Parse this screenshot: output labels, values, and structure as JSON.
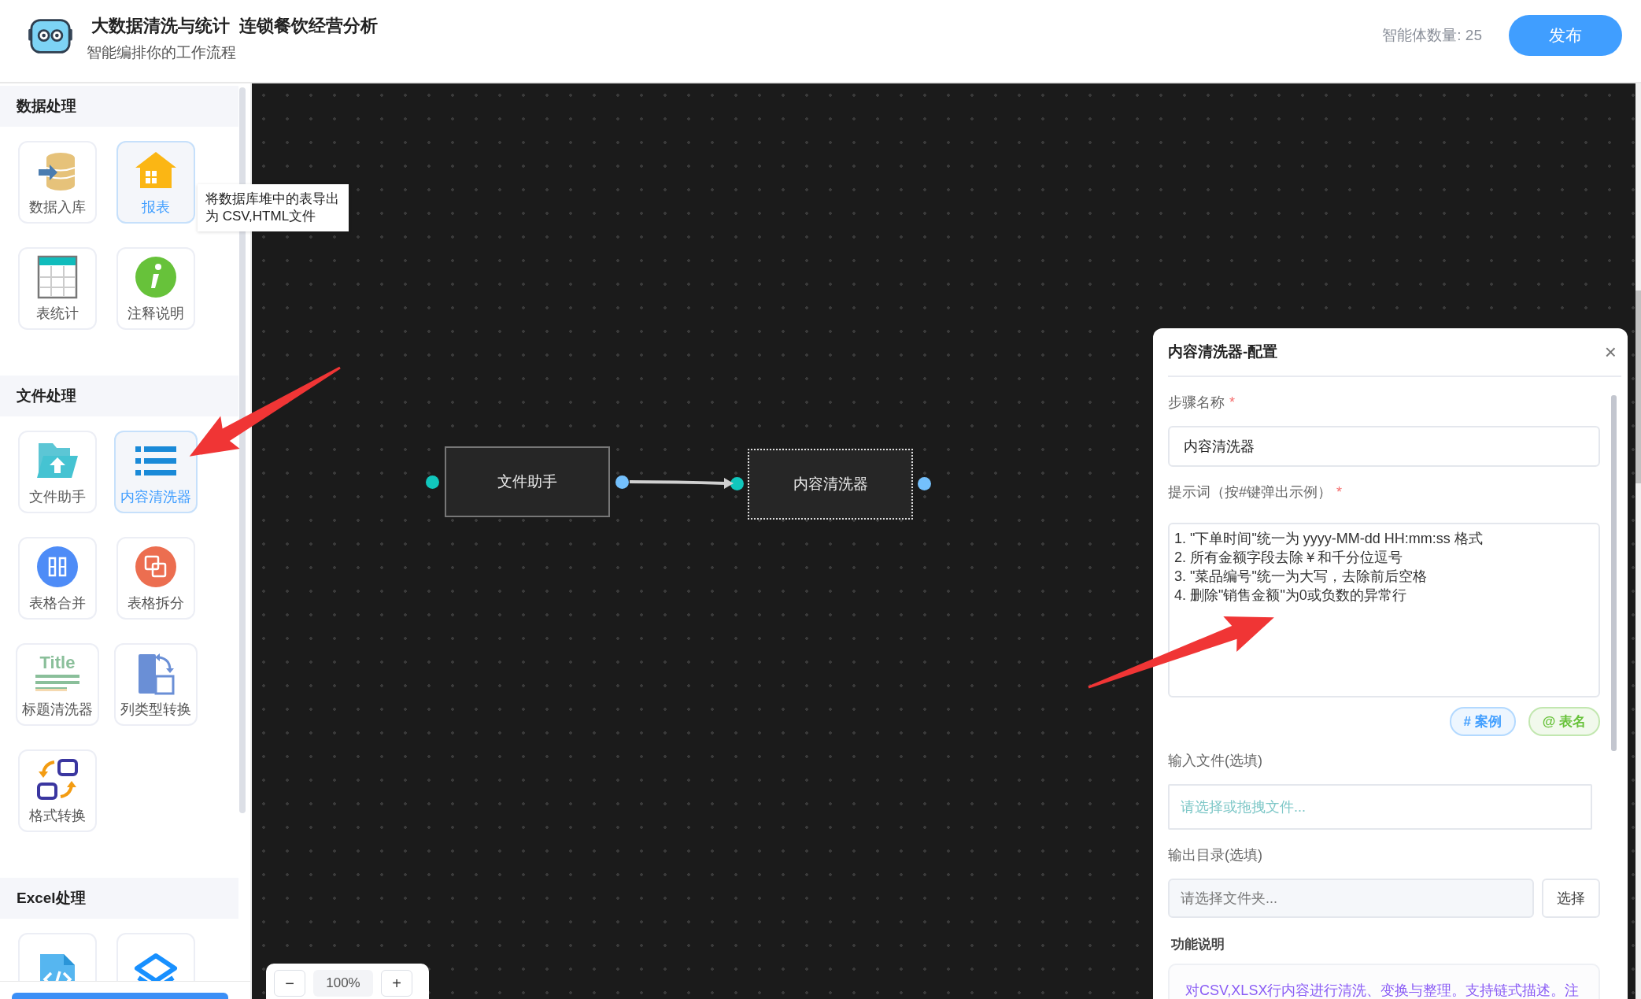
{
  "header": {
    "title": "大数据清洗与统计  连锁餐饮经营分析",
    "subtitle": "智能编排你的工作流程",
    "agent_count": "智能体数量: 25",
    "publish_button": "发布"
  },
  "sidebar": {
    "sections": [
      {
        "title": "数据处理",
        "tools": [
          {
            "label": "数据入库",
            "selected": false
          },
          {
            "label": "报表",
            "selected": true
          },
          {
            "label": "表统计",
            "selected": false
          },
          {
            "label": "注释说明",
            "selected": false
          }
        ]
      },
      {
        "title": "文件处理",
        "tools": [
          {
            "label": "文件助手",
            "selected": false
          },
          {
            "label": "内容清洗器",
            "selected": true
          },
          {
            "label": "表格合并",
            "selected": false
          },
          {
            "label": "表格拆分",
            "selected": false
          },
          {
            "label": "标题清洗器",
            "icon_text": "Title",
            "selected": false
          },
          {
            "label": "列类型转换",
            "selected": false
          },
          {
            "label": "格式转换",
            "selected": false
          }
        ]
      },
      {
        "title": "Excel处理",
        "tools": [
          {
            "selected": false
          },
          {
            "selected": false
          }
        ]
      }
    ]
  },
  "tooltip": {
    "text": "将数据库堆中的表导出为 CSV,HTML文件"
  },
  "canvas": {
    "nodes": [
      {
        "label": "文件助手",
        "selected": false
      },
      {
        "label": "内容清洗器",
        "selected": true
      }
    ],
    "zoom": {
      "minus": "−",
      "level": "100%",
      "plus": "+"
    }
  },
  "config_panel": {
    "title": "内容清洗器-配置",
    "close": "×",
    "step_name": {
      "label": "步骤名称",
      "required_mark": "*",
      "value": "内容清洗器"
    },
    "prompt": {
      "label": "提示词（按#键弹出示例）",
      "required_mark": "*",
      "value": "1. \"下单时间\"统一为 yyyy-MM-dd HH:mm:ss 格式\n2. 所有金额字段去除￥和千分位逗号\n3. \"菜品编号\"统一为大写，去除前后空格\n4. 删除\"销售金额\"为0或负数的异常行"
    },
    "tags": [
      {
        "label": "# 案例",
        "color": "#409eff"
      },
      {
        "label": "@ 表名",
        "color": "#67c23a"
      }
    ],
    "input_file": {
      "label": "输入文件(选填)",
      "placeholder": "请选择或拖拽文件..."
    },
    "output_dir": {
      "label": "输出目录(选填)",
      "placeholder": "请选择文件夹...",
      "button": "选择"
    },
    "description": {
      "title": "功能说明",
      "text": "对CSV,XLSX行内容进行清洗、变换与整理。支持链式描述。注"
    }
  }
}
